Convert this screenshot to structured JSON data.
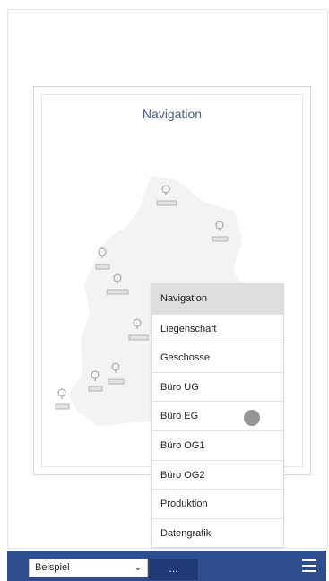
{
  "card": {
    "title": "Navigation"
  },
  "menu": {
    "items": [
      {
        "label": "Navigation",
        "active": true
      },
      {
        "label": "Liegenschaft",
        "active": false
      },
      {
        "label": "Geschosse",
        "active": false
      },
      {
        "label": "Büro UG",
        "active": false
      },
      {
        "label": "Büro EG",
        "active": false
      },
      {
        "label": "Büro OG1",
        "active": false
      },
      {
        "label": "Büro OG2",
        "active": false
      },
      {
        "label": "Produktion",
        "active": false
      },
      {
        "label": "Datengrafik",
        "active": false
      }
    ]
  },
  "bottom_bar": {
    "select_value": "Beispiel",
    "dots_label": "...",
    "menu_icon": "hamburger-icon"
  },
  "colors": {
    "bar": "#2e4e8e",
    "title": "#4a5a8a",
    "active_menu": "#dedede"
  },
  "map": {
    "pin_icon": "map-pin-icon"
  }
}
